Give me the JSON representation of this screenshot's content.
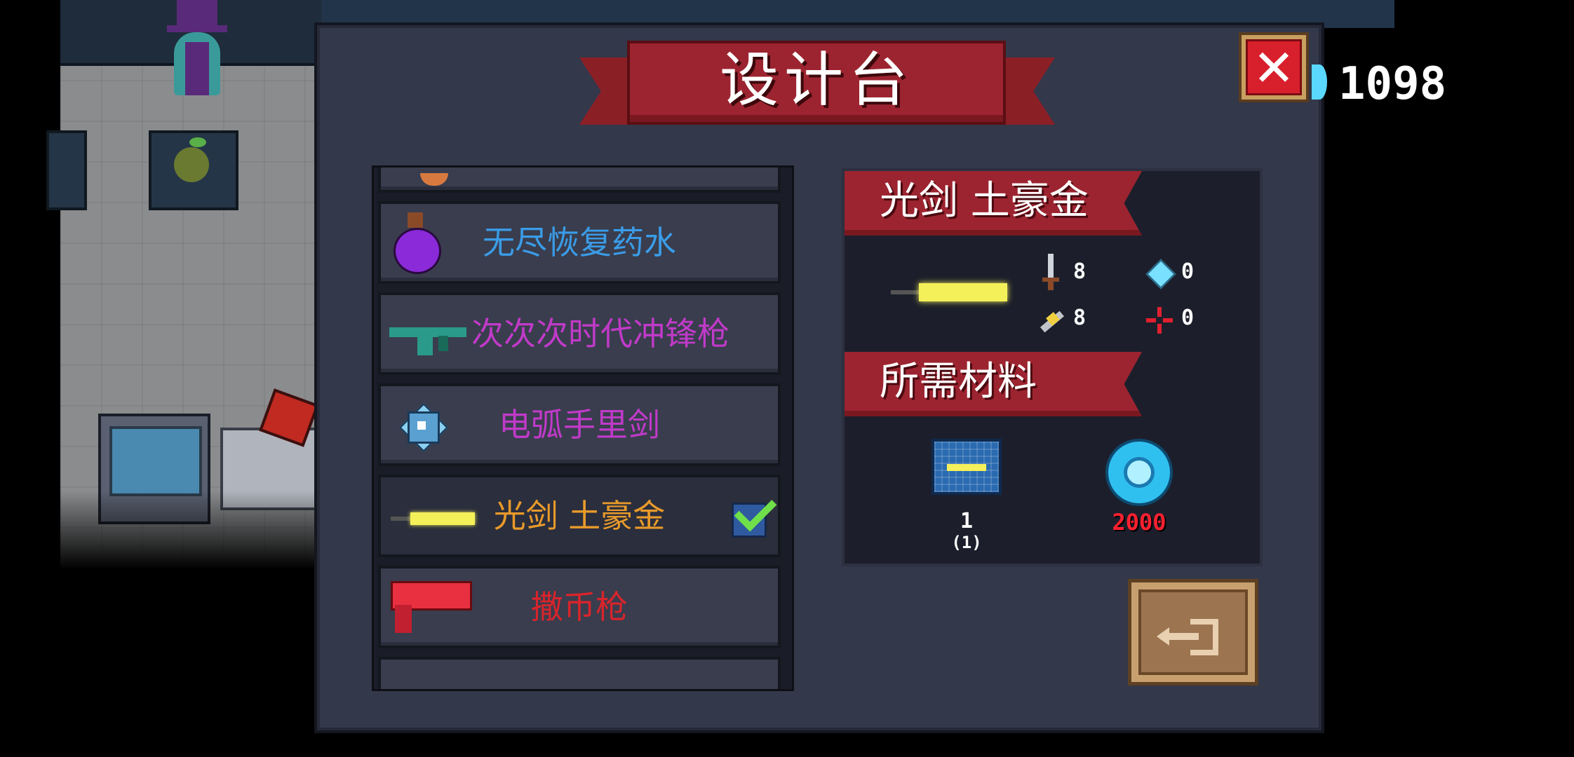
{
  "currency": {
    "gems": "1098",
    "gem_icon": "blue-gem-icon"
  },
  "dialog": {
    "title": "设计台",
    "close_icon": "close-x-icon"
  },
  "weapon_list": [
    {
      "name": "无尽恢复药水",
      "color": "#3a9ce8",
      "icon": "purple-potion-icon"
    },
    {
      "name": "次次次时代冲锋枪",
      "color": "#c03ac8",
      "icon": "green-smg-icon"
    },
    {
      "name": "电弧手里剑",
      "color": "#c03ac8",
      "icon": "shuriken-icon"
    },
    {
      "name": "光剑 土豪金",
      "color": "#e89a2a",
      "icon": "yellow-lightsaber-icon",
      "selected": true
    },
    {
      "name": "撒币枪",
      "color": "#d8242c",
      "icon": "red-coin-gun-icon"
    }
  ],
  "detail": {
    "name": "光剑 土豪金",
    "stats": {
      "damage": "8",
      "energy": "0",
      "crit": "8",
      "spread": "0"
    },
    "materials_title": "所需材料",
    "materials": [
      {
        "icon": "lightsaber-blueprint-icon",
        "amount": "1",
        "owned": "(1)"
      },
      {
        "icon": "blue-gem-coin-icon",
        "amount": "2000"
      }
    ]
  },
  "exit_icon": "exit-door-icon"
}
